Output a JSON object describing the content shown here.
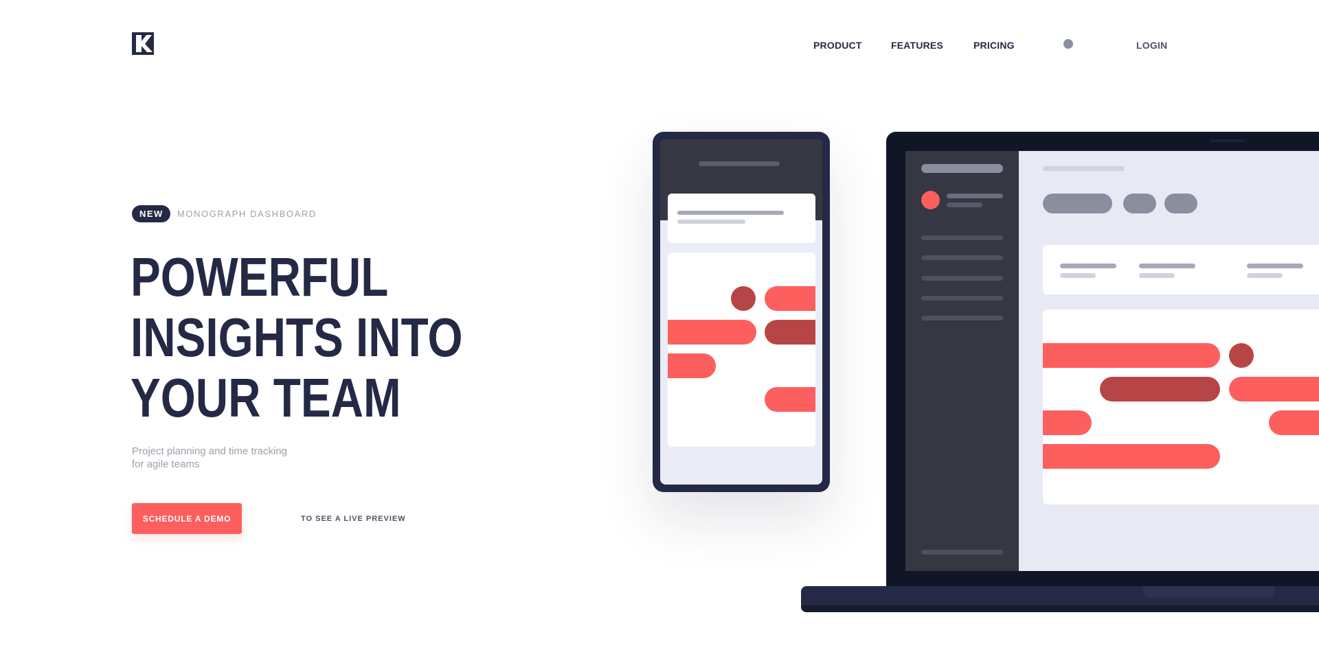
{
  "brand": {
    "logo_icon": "monograph-k-logo-icon"
  },
  "nav": {
    "items": [
      {
        "label": "PRODUCT"
      },
      {
        "label": "FEATURES"
      },
      {
        "label": "PRICING"
      }
    ],
    "login_label": "LOGIN"
  },
  "hero": {
    "badge": "NEW",
    "badge_caption": "MONOGRAPH DASHBOARD",
    "headline_lines": [
      "POWERFUL",
      "INSIGHTS INTO",
      "YOUR TEAM"
    ],
    "subtitle_lines": [
      "Project planning and time tracking",
      "for agile teams"
    ],
    "cta_label": "SCHEDULE A DEMO",
    "preview_label": "TO SEE A LIVE PREVIEW"
  },
  "colors": {
    "navy": "#242a45",
    "coral": "#fd5e5e",
    "coral_dark": "#b84545",
    "muted": "#9ea0ab",
    "sidebar": "#353742",
    "canvas": "#e7eaf4"
  }
}
